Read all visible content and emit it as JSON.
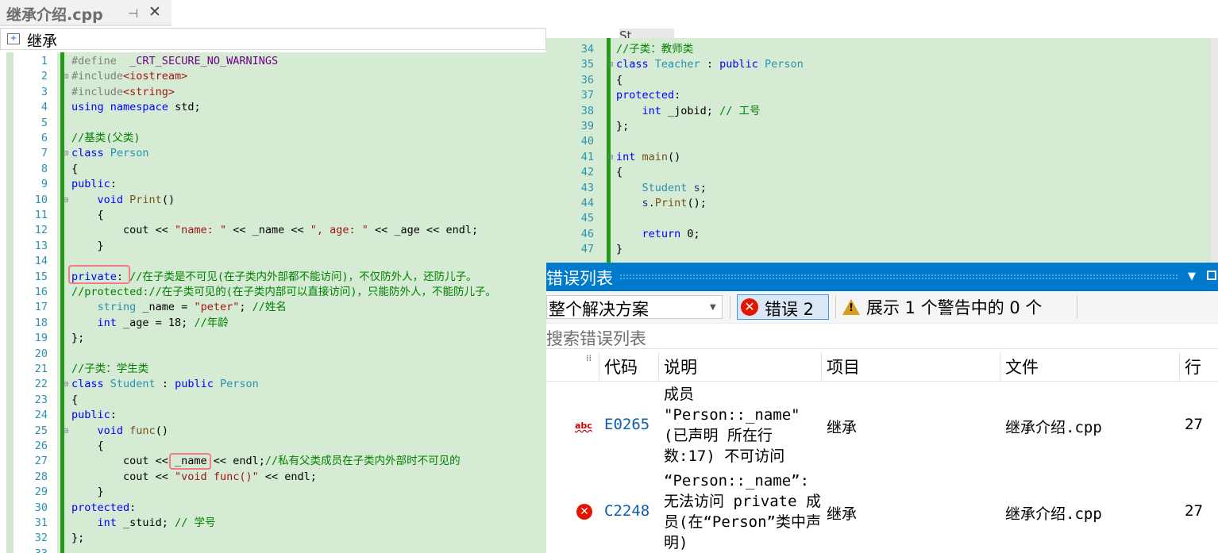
{
  "tab": {
    "title": "继承介绍.cpp",
    "pin": "⊣",
    "close": "✕"
  },
  "nav": {
    "scope": "继承"
  },
  "left_lines": [
    "1",
    "2",
    "3",
    "4",
    "5",
    "6",
    "7",
    "8",
    "9",
    "10",
    "11",
    "12",
    "13",
    "14",
    "15",
    "16",
    "17",
    "18",
    "19",
    "20",
    "21",
    "22",
    "23",
    "24",
    "25",
    "26",
    "27",
    "28",
    "29",
    "30",
    "31",
    "32",
    "33"
  ],
  "left_code": [
    "#define  _CRT_SECURE_NO_WARNINGS",
    "#include<iostream>",
    "#include<string>",
    "using namespace std;",
    "",
    "//基类(父类)",
    "class Person",
    "{",
    "public:",
    "    void Print()",
    "    {",
    "        cout << \"name: \" << _name << \", age: \" << _age << endl;",
    "    }",
    "",
    "private: //在子类是不可见(在子类内外部都不能访问)，不仅防外人，还防儿子。",
    "//protected://在子类可见的(在子类内部可以直接访问)，只能防外人，不能防儿子。",
    "    string _name = \"peter\"; //姓名",
    "    int _age = 18; //年龄",
    "};",
    "",
    "//子类：学生类",
    "class Student : public Person",
    "{",
    "public:",
    "    void func()",
    "    {",
    "        cout << _name << endl;//私有父类成员在子类内外部时不可见的",
    "        cout << \"void func()\" << endl;",
    "    }",
    "protected:",
    "    int _stuid; // 学号",
    "};",
    ""
  ],
  "right_tab_stub": "St",
  "right_lines": [
    "34",
    "35",
    "36",
    "37",
    "38",
    "39",
    "40",
    "41",
    "42",
    "43",
    "44",
    "45",
    "46",
    "47"
  ],
  "right_code": [
    "//子类：教师类",
    "class Teacher : public Person",
    "{",
    "protected:",
    "    int _jobid; // 工号",
    "};",
    "",
    "int main()",
    "{",
    "    Student s;",
    "    s.Print();",
    "",
    "    return 0;",
    "}"
  ],
  "error_list": {
    "title": "错误列表",
    "scope_select": "整个解决方案",
    "errors_button": "错误 2",
    "warnings_text": "展示 1 个警告中的 0 个",
    "search_placeholder": "搜索错误列表",
    "columns": {
      "code": "代码",
      "desc": "说明",
      "project": "项目",
      "file": "文件",
      "line": "行"
    },
    "rows": [
      {
        "icon": "abc",
        "code": "E0265",
        "desc": "成员 \"Person::_name\" (已声明 所在行数:17) 不可访问",
        "project": "继承",
        "file": "继承介绍.cpp",
        "line": "27"
      },
      {
        "icon": "✕",
        "code": "C2248",
        "desc": "“Person::_name”: 无法访问 private 成员(在“Person”类中声明)",
        "project": "继承",
        "file": "继承介绍.cpp",
        "line": "27"
      }
    ]
  },
  "colors": {
    "editor_bg": "#d5ebd3",
    "change_bar": "#249a1b",
    "line_number": "#2b91af",
    "titlebar": "#007acc",
    "error_red": "#e51400"
  }
}
